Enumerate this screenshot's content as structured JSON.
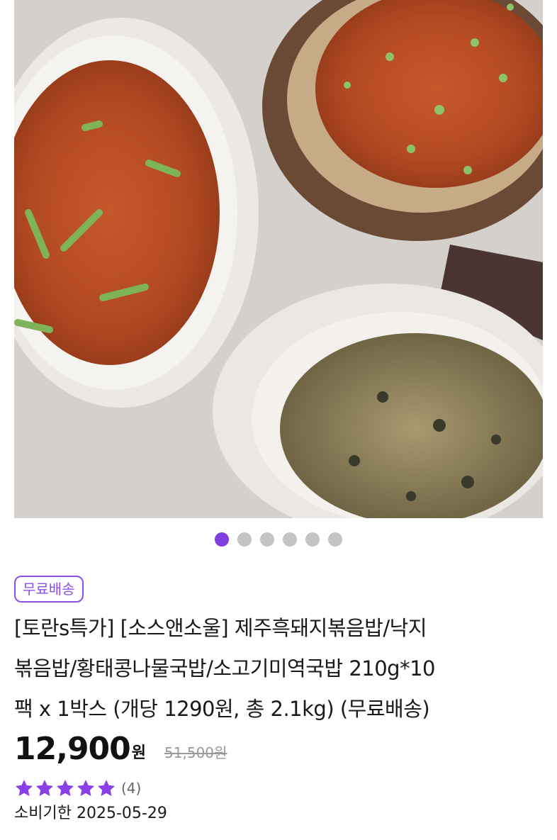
{
  "product": {
    "image_alt_icon": "fried-rice-photo",
    "carousel": {
      "total": 6,
      "current": 1
    },
    "badge": "무료배송",
    "title_lines": [
      "[토란s특가] [소스앤소울] 제주흑돼지볶음밥/낙지",
      "볶음밥/황태콩나물국밥/소고기미역국밥 210g*10",
      "팩 x 1박스 (개당 1290원, 총 2.1kg) (무료배송)"
    ],
    "price": "12,900",
    "price_unit": "원",
    "original_price": "51,500원",
    "rating_stars": 5,
    "review_count": "(4)",
    "expiry_label": "소비기한",
    "expiry_date": "2025-05-29"
  },
  "colors": {
    "accent": "#7f3fe0",
    "star": "#8b3fe8",
    "badge": "#8b50e6"
  }
}
